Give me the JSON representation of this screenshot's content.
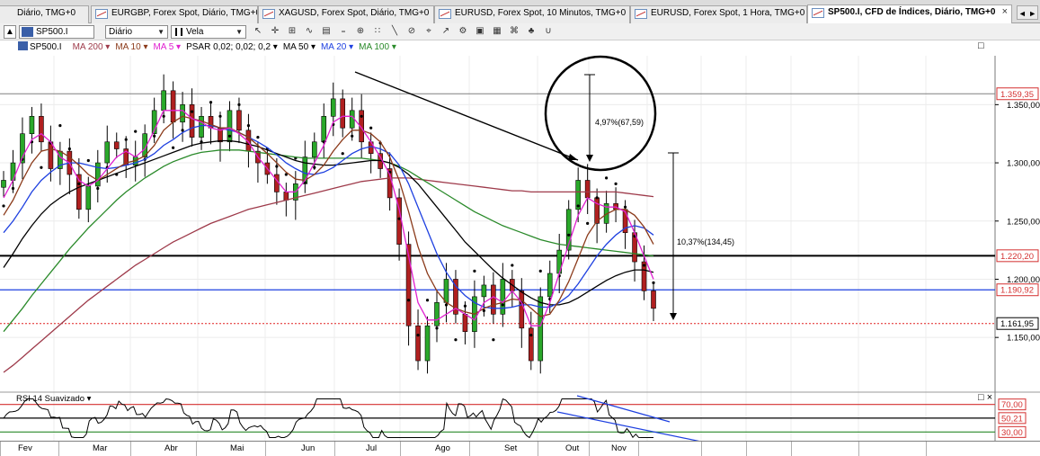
{
  "tabs": [
    {
      "label": "Diário, TMG+0",
      "active": false
    },
    {
      "label": "EURGBP, Forex Spot, Diário, TMG+0",
      "active": false
    },
    {
      "label": "XAGUSD, Forex Spot, Diário, TMG+0",
      "active": false
    },
    {
      "label": "EURUSD, Forex Spot, 10 Minutos, TMG+0",
      "active": false
    },
    {
      "label": "EURUSD, Forex Spot, 1 Hora, TMG+0",
      "active": false
    },
    {
      "label": "SP500.I, CFD de Índices, Diário, TMG+0",
      "active": true
    }
  ],
  "tab_close_glyph": "×",
  "tab_scroll_glyph": "◄ ►",
  "toolbar": {
    "symbol": "SP500.I",
    "period": "Diário",
    "chart_style": "Vela",
    "collapse_glyph": "▲",
    "tool_glyphs": [
      "↖",
      "✛",
      "⊞",
      "∿",
      "▤",
      "₌",
      "⊕",
      "∷",
      "╲",
      "⊘",
      "⌖",
      "↗",
      "⚙",
      "▣",
      "▦",
      "⌘",
      "♣",
      "∪"
    ]
  },
  "legend": {
    "symbol": "SP500.I",
    "items": [
      {
        "label": "MA 200 ▾",
        "color": "#9e3a4a"
      },
      {
        "label": "MA 10 ▾",
        "color": "#8b3a1a"
      },
      {
        "label": "MA 5 ▾",
        "color": "#e020d0"
      },
      {
        "label": "PSAR 0,02; 0,02; 0,2 ▾",
        "color": "#000000"
      },
      {
        "label": "MA 50 ▾",
        "color": "#000000"
      },
      {
        "label": "MA 20 ▾",
        "color": "#1e40e0"
      },
      {
        "label": "MA 100 ▾",
        "color": "#2a8a2a"
      }
    ],
    "maximize_glyph": "□"
  },
  "price_levels": [
    {
      "label": "1.359,35",
      "value": 1359.35,
      "color": "#d43030",
      "line": "#808080"
    },
    {
      "label": "1.220,20",
      "value": 1220.2,
      "color": "#d43030",
      "line": "#000000"
    },
    {
      "label": "1.190,92",
      "value": 1190.92,
      "color": "#d43030",
      "line": "#1e40e0"
    },
    {
      "label": "1.161,95",
      "value": 1161.95,
      "color": "#000000",
      "line": "#e02020"
    }
  ],
  "annotations": {
    "move_small": "4,97%(67,59)",
    "move_large": "10,37%(134,45)"
  },
  "rsi": {
    "label": "RSI 14 Suavizado ▾",
    "levels": [
      {
        "label": "70,00",
        "value": 70,
        "color": "#d43030"
      },
      {
        "label": "50,21",
        "value": 50.21,
        "color": "#d43030"
      },
      {
        "label": "30,00",
        "value": 30,
        "color": "#d43030"
      }
    ],
    "controls_glyph": "□ ×"
  },
  "chart_data": {
    "type": "line",
    "title": "",
    "ylabel": "",
    "xlabel": "",
    "ylim": [
      1103,
      1392
    ],
    "y_ticks": [
      "1.350,00",
      "1.300,00",
      "1.250,00",
      "1.200,00",
      "1.150,00"
    ],
    "y_tick_values": [
      1350,
      1300,
      1250,
      1200,
      1150
    ],
    "x_ticks": [
      "Fev",
      "Mar",
      "Abr",
      "Mai",
      "Jun",
      "Jul",
      "Ago",
      "Set",
      "Out",
      "Nov"
    ],
    "series": [
      {
        "key": "close",
        "color": "#000000",
        "values": [
          1285,
          1300,
          1325,
          1340,
          1318,
          1295,
          1310,
          1290,
          1260,
          1280,
          1300,
          1318,
          1312,
          1298,
          1305,
          1325,
          1345,
          1362,
          1335,
          1350,
          1322,
          1340,
          1330,
          1318,
          1345,
          1328,
          1310,
          1300,
          1290,
          1275,
          1268,
          1282,
          1305,
          1318,
          1340,
          1355,
          1330,
          1345,
          1318,
          1308,
          1295,
          1270,
          1230,
          1160,
          1130,
          1160,
          1180,
          1200,
          1170,
          1155,
          1185,
          1195,
          1170,
          1200,
          1190,
          1158,
          1130,
          1185,
          1205,
          1225,
          1260,
          1285,
          1270,
          1248,
          1265,
          1260,
          1240,
          1215,
          1190,
          1175
        ]
      },
      {
        "key": "MA 5",
        "color": "#e020d0",
        "values": [
          1270,
          1285,
          1305,
          1320,
          1325,
          1318,
          1305,
          1300,
          1285,
          1280,
          1285,
          1295,
          1305,
          1310,
          1305,
          1312,
          1328,
          1345,
          1345,
          1345,
          1338,
          1335,
          1330,
          1328,
          1330,
          1325,
          1318,
          1305,
          1295,
          1285,
          1275,
          1275,
          1285,
          1300,
          1315,
          1335,
          1340,
          1340,
          1330,
          1318,
          1305,
          1290,
          1260,
          1220,
          1180,
          1165,
          1165,
          1170,
          1175,
          1170,
          1165,
          1180,
          1185,
          1180,
          1190,
          1180,
          1160,
          1160,
          1180,
          1205,
          1230,
          1255,
          1270,
          1265,
          1262,
          1262,
          1258,
          1240,
          1220,
          1200
        ]
      },
      {
        "key": "MA 10",
        "color": "#8b3a1a",
        "values": [
          1255,
          1268,
          1285,
          1300,
          1310,
          1312,
          1310,
          1305,
          1298,
          1290,
          1285,
          1290,
          1295,
          1300,
          1302,
          1306,
          1315,
          1328,
          1335,
          1340,
          1338,
          1336,
          1333,
          1330,
          1330,
          1326,
          1322,
          1315,
          1308,
          1300,
          1292,
          1286,
          1285,
          1290,
          1298,
          1310,
          1320,
          1328,
          1328,
          1325,
          1318,
          1305,
          1285,
          1258,
          1228,
          1205,
          1190,
          1180,
          1175,
          1172,
          1170,
          1175,
          1178,
          1180,
          1183,
          1182,
          1175,
          1168,
          1170,
          1182,
          1198,
          1218,
          1238,
          1250,
          1256,
          1260,
          1260,
          1255,
          1245,
          1230
        ]
      },
      {
        "key": "MA 20",
        "color": "#1e40e0",
        "values": [
          1240,
          1250,
          1262,
          1275,
          1285,
          1292,
          1298,
          1300,
          1300,
          1298,
          1296,
          1295,
          1296,
          1298,
          1300,
          1303,
          1308,
          1315,
          1320,
          1326,
          1330,
          1332,
          1332,
          1330,
          1328,
          1326,
          1322,
          1318,
          1313,
          1307,
          1300,
          1295,
          1291,
          1290,
          1292,
          1296,
          1302,
          1308,
          1312,
          1314,
          1312,
          1308,
          1298,
          1282,
          1262,
          1242,
          1222,
          1206,
          1194,
          1186,
          1180,
          1176,
          1175,
          1175,
          1176,
          1178,
          1178,
          1176,
          1176,
          1180,
          1186,
          1196,
          1208,
          1220,
          1230,
          1238,
          1244,
          1246,
          1244,
          1238
        ]
      },
      {
        "key": "MA 50",
        "color": "#000000",
        "values": [
          1210,
          1222,
          1235,
          1246,
          1256,
          1264,
          1270,
          1275,
          1279,
          1282,
          1285,
          1288,
          1291,
          1294,
          1297,
          1300,
          1303,
          1306,
          1309,
          1312,
          1315,
          1317,
          1318,
          1319,
          1319,
          1318,
          1316,
          1314,
          1311,
          1308,
          1305,
          1302,
          1300,
          1299,
          1298,
          1298,
          1299,
          1300,
          1301,
          1302,
          1302,
          1300,
          1296,
          1290,
          1282,
          1272,
          1262,
          1252,
          1242,
          1232,
          1224,
          1216,
          1208,
          1201,
          1195,
          1189,
          1184,
          1180,
          1178,
          1178,
          1180,
          1184,
          1189,
          1194,
          1199,
          1203,
          1206,
          1208,
          1208,
          1206
        ]
      },
      {
        "key": "MA 100",
        "color": "#2a8a2a",
        "values": [
          1155,
          1165,
          1175,
          1186,
          1196,
          1206,
          1216,
          1226,
          1235,
          1244,
          1252,
          1260,
          1268,
          1275,
          1281,
          1287,
          1292,
          1297,
          1301,
          1304,
          1307,
          1309,
          1310,
          1311,
          1311,
          1311,
          1310,
          1309,
          1308,
          1307,
          1306,
          1305,
          1304,
          1304,
          1304,
          1304,
          1304,
          1304,
          1304,
          1303,
          1302,
          1300,
          1297,
          1293,
          1288,
          1283,
          1278,
          1273,
          1268,
          1263,
          1258,
          1254,
          1250,
          1246,
          1243,
          1240,
          1237,
          1234,
          1232,
          1230,
          1229,
          1228,
          1227,
          1226,
          1225,
          1224,
          1223,
          1222,
          1221,
          1220
        ]
      },
      {
        "key": "MA 200",
        "color": "#9e3a4a",
        "values": [
          1120,
          1126,
          1133,
          1140,
          1147,
          1154,
          1161,
          1168,
          1175,
          1182,
          1188,
          1194,
          1200,
          1206,
          1212,
          1217,
          1222,
          1227,
          1232,
          1236,
          1240,
          1244,
          1248,
          1251,
          1254,
          1257,
          1260,
          1262,
          1264,
          1266,
          1268,
          1270,
          1272,
          1274,
          1276,
          1278,
          1280,
          1282,
          1284,
          1285,
          1286,
          1287,
          1287,
          1287,
          1286,
          1285,
          1284,
          1283,
          1282,
          1281,
          1280,
          1279,
          1278,
          1277,
          1276,
          1276,
          1275,
          1275,
          1275,
          1275,
          1275,
          1275,
          1275,
          1275,
          1275,
          1275,
          1274,
          1273,
          1272,
          1271
        ]
      }
    ],
    "trendlines": [
      {
        "x1": 0.334,
        "y1": 1362,
        "x2": 0.545,
        "y2": 1285
      },
      {
        "x1": 0.545,
        "y1": 1120,
        "x2": 0.665,
        "y2": 1095
      }
    ]
  }
}
